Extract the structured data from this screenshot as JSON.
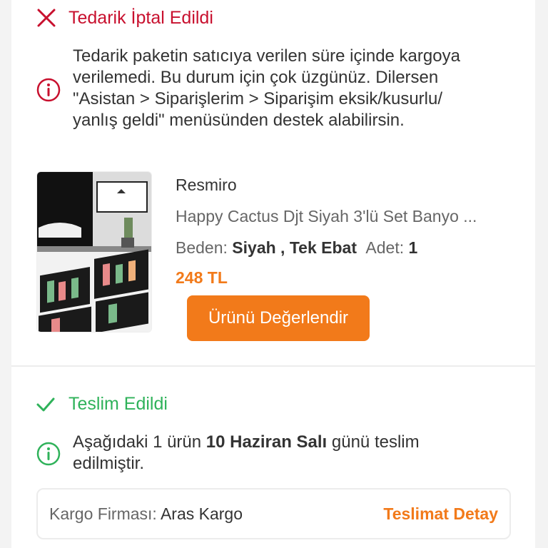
{
  "cancelled": {
    "title": "Tedarik İptal Edildi",
    "message_lines": [
      "Tedarik paketin satıcıya verilen süre içinde kargoya",
      "verilemedi. Bu durum için çok üzgünüz. Dilersen",
      "\"Asistan > Siparişlerim > Siparişim eksik/kusurlu/",
      "yanlış geldi\" menüsünden destek alabilirsin."
    ],
    "colors": {
      "status": "#c8102e"
    },
    "icons": {
      "status": "close-icon",
      "message": "info-icon"
    }
  },
  "product": {
    "brand": "Resmiro",
    "name": "Happy Cactus Djt Siyah 3'lü Set Banyo ...",
    "size_label": "Beden:",
    "size_value": "Siyah , Tek Ebat",
    "qty_label": "Adet:",
    "qty_value": "1",
    "price": "248 TL",
    "rate_button": "Ürünü Değerlendir",
    "image_icon": "product-image"
  },
  "delivered": {
    "title": "Teslim Edildi",
    "message_prefix": "Aşağıdaki 1 ürün ",
    "message_date": "10 Haziran Salı",
    "message_suffix": " günü teslim",
    "message_line2": "edilmiştir.",
    "colors": {
      "status": "#2fb25a"
    },
    "icons": {
      "status": "check-icon",
      "message": "info-icon"
    }
  },
  "cargo": {
    "label": "Kargo Firması:",
    "company": "Aras Kargo",
    "detail_link": "Teslimat Detay"
  },
  "colors": {
    "accent": "#f27a1a"
  }
}
